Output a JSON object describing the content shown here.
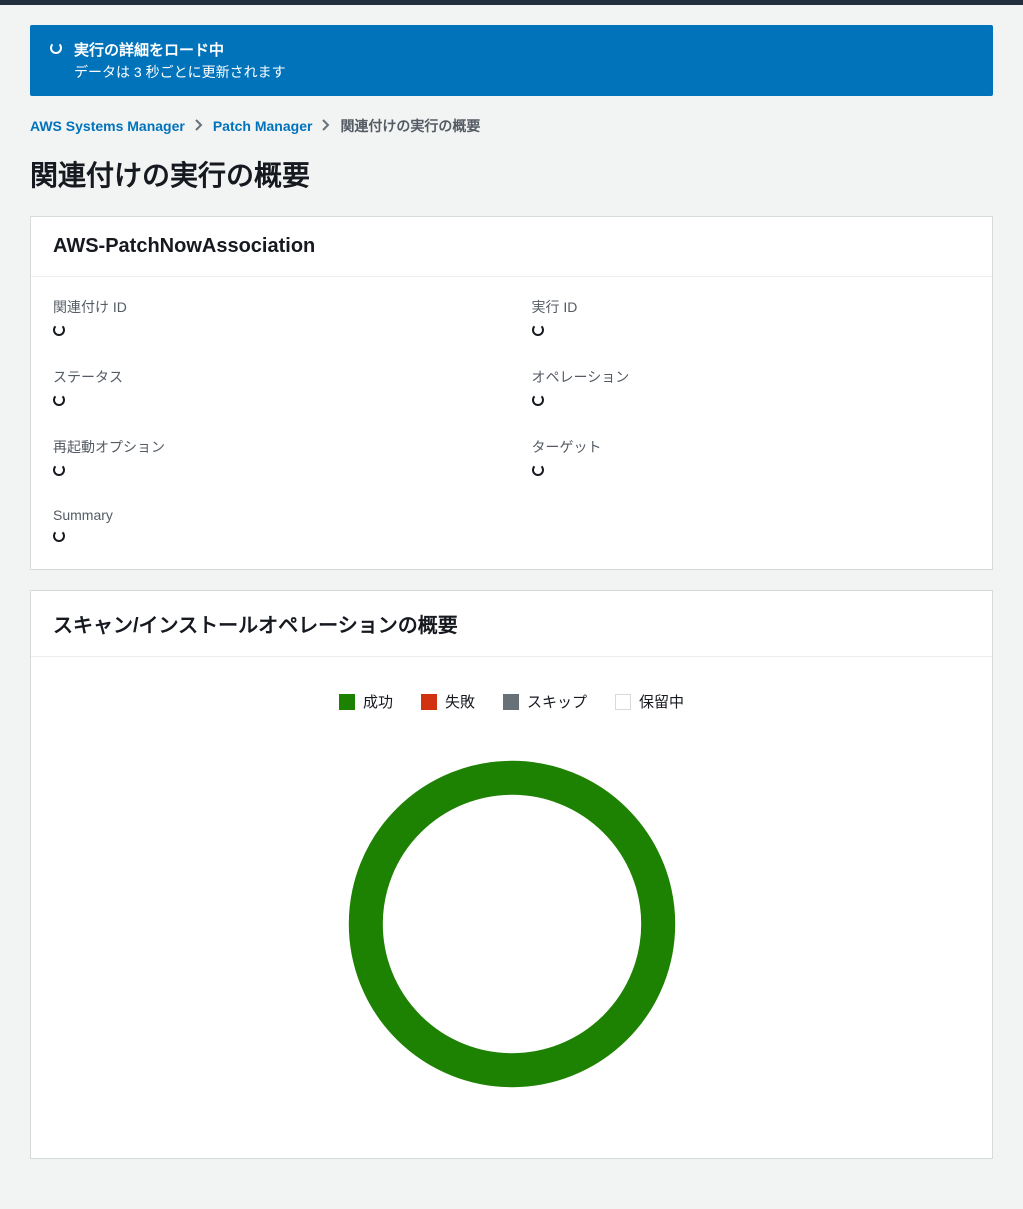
{
  "flash": {
    "title": "実行の詳細をロード中",
    "description": "データは 3 秒ごとに更新されます"
  },
  "breadcrumbs": {
    "items": [
      {
        "label": "AWS Systems Manager",
        "link": true
      },
      {
        "label": "Patch Manager",
        "link": true
      },
      {
        "label": "関連付けの実行の概要",
        "link": false
      }
    ]
  },
  "page_title": "関連付けの実行の概要",
  "details_panel": {
    "title": "AWS-PatchNowAssociation",
    "fields": {
      "association_id": {
        "label": "関連付け ID"
      },
      "execution_id": {
        "label": "実行 ID"
      },
      "status": {
        "label": "ステータス"
      },
      "operation": {
        "label": "オペレーション"
      },
      "reboot_option": {
        "label": "再起動オプション"
      },
      "targets": {
        "label": "ターゲット"
      },
      "summary": {
        "label": "Summary"
      }
    }
  },
  "chart_panel": {
    "title": "スキャン/インストールオペレーションの概要"
  },
  "chart_data": {
    "type": "pie",
    "subtype": "donut",
    "title": "スキャン/インストールオペレーションの概要",
    "series": [
      {
        "name": "成功",
        "value": 100,
        "color": "#1d8102"
      },
      {
        "name": "失敗",
        "value": 0,
        "color": "#d13212"
      },
      {
        "name": "スキップ",
        "value": 0,
        "color": "#687078"
      },
      {
        "name": "保留中",
        "value": 0,
        "color": "#ffffff"
      }
    ],
    "legend_position": "top"
  }
}
